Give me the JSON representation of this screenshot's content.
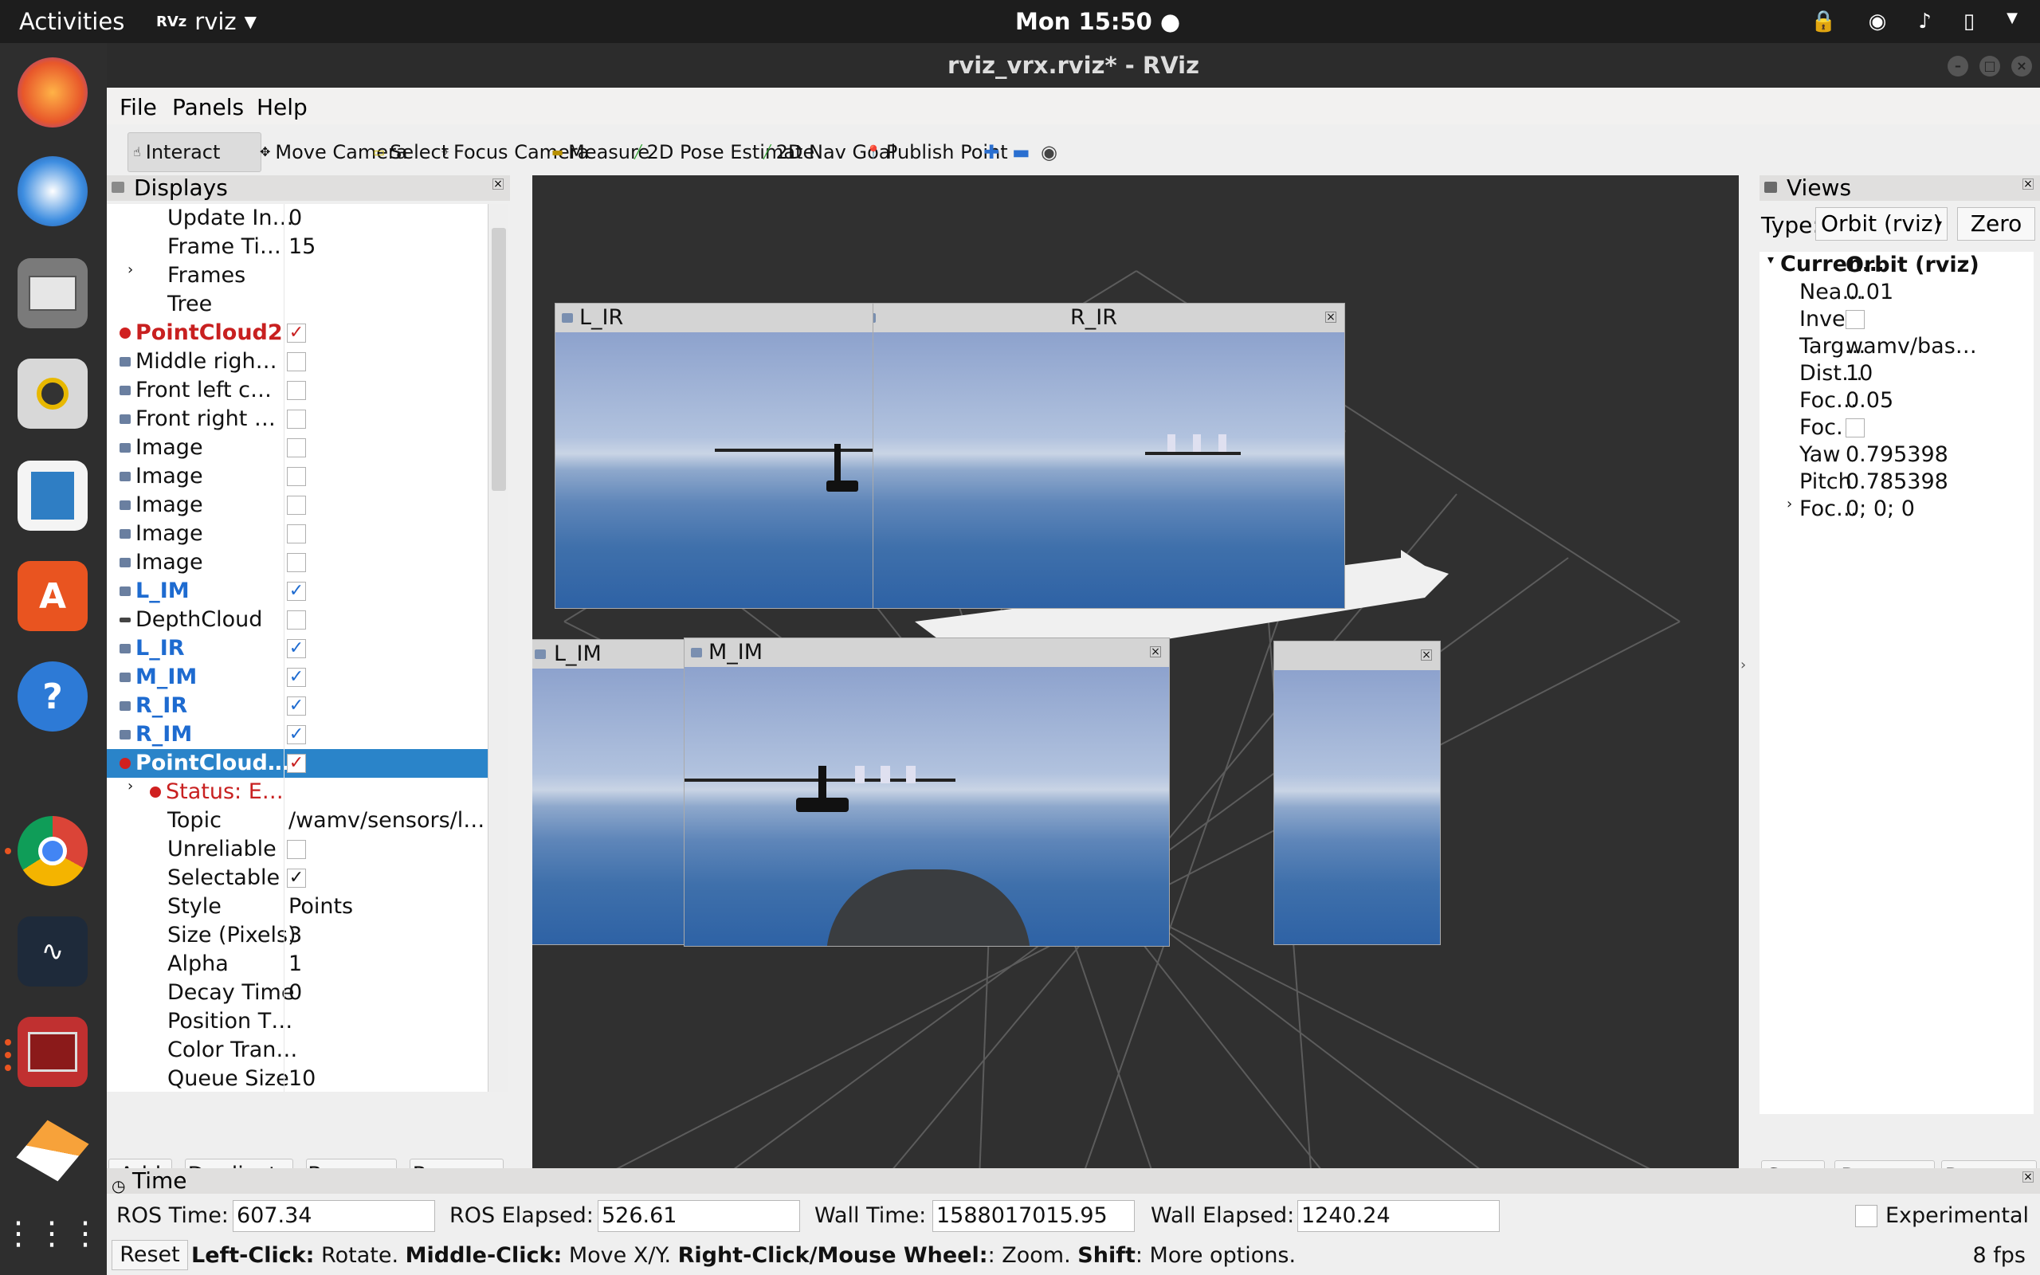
{
  "topbar": {
    "activities": "Activities",
    "app_name": "rviz",
    "app_logo": "RVz",
    "clock": "Mon 15:50 ●"
  },
  "window": {
    "title": "rviz_vrx.rviz* - RViz"
  },
  "menu": [
    "File",
    "Panels",
    "Help"
  ],
  "toolbar": {
    "interact": "Interact",
    "move_camera": "Move Camera",
    "select": "Select",
    "focus_camera": "Focus Camera",
    "measure": "Measure",
    "pose_estimate": "2D Pose Estimate",
    "nav_goal": "2D Nav Goal",
    "publish_point": "Publish Point"
  },
  "displays": {
    "title": "Displays",
    "rows": [
      {
        "name": "Update In…",
        "value": "0"
      },
      {
        "name": "Frame Ti…",
        "value": "15"
      },
      {
        "name": "Frames",
        "value": ""
      },
      {
        "name": "Tree",
        "value": ""
      },
      {
        "name": "PointCloud2",
        "value": ""
      },
      {
        "name": "Middle righ…",
        "value": ""
      },
      {
        "name": "Front left c…",
        "value": ""
      },
      {
        "name": "Front right …",
        "value": ""
      },
      {
        "name": "Image",
        "value": ""
      },
      {
        "name": "Image",
        "value": ""
      },
      {
        "name": "Image",
        "value": ""
      },
      {
        "name": "Image",
        "value": ""
      },
      {
        "name": "Image",
        "value": ""
      },
      {
        "name": "L_IM",
        "value": ""
      },
      {
        "name": "DepthCloud",
        "value": ""
      },
      {
        "name": "L_IR",
        "value": ""
      },
      {
        "name": "M_IM",
        "value": ""
      },
      {
        "name": "R_IR",
        "value": ""
      },
      {
        "name": "R_IM",
        "value": ""
      },
      {
        "name": "PointCloud…",
        "value": ""
      },
      {
        "name": "Status: E…",
        "value": ""
      },
      {
        "name": "Topic",
        "value": "/wamv/sensors/l…"
      },
      {
        "name": "Unreliable",
        "value": ""
      },
      {
        "name": "Selectable",
        "value": ""
      },
      {
        "name": "Style",
        "value": "Points"
      },
      {
        "name": "Size (Pixels)",
        "value": "3"
      },
      {
        "name": "Alpha",
        "value": "1"
      },
      {
        "name": "Decay Time",
        "value": "0"
      },
      {
        "name": "Position T…",
        "value": ""
      },
      {
        "name": "Color Tran…",
        "value": ""
      },
      {
        "name": "Queue Size",
        "value": "10"
      }
    ],
    "buttons": {
      "add": "Add",
      "duplicate": "Duplicate",
      "remove": "Remove",
      "rename": "Rename"
    }
  },
  "image_windows": {
    "l_ir": "L_IR",
    "r_ir": "R_IR",
    "l_im": "L_IM",
    "m_im": "M_IM"
  },
  "views": {
    "title": "Views",
    "type_label": "Type:",
    "type_value": "Orbit (rviz)",
    "zero": "Zero",
    "current_name": "Curren…",
    "current_value": "Orbit (rviz)",
    "props": [
      {
        "name": "Nea…",
        "value": "0.01"
      },
      {
        "name": "Inve…",
        "value": ""
      },
      {
        "name": "Targ…",
        "value": "wamv/bas…"
      },
      {
        "name": "Dist…",
        "value": "10"
      },
      {
        "name": "Foc…",
        "value": "0.05"
      },
      {
        "name": "Foc…",
        "value": ""
      },
      {
        "name": "Yaw",
        "value": "0.795398"
      },
      {
        "name": "Pitch",
        "value": "0.785398"
      },
      {
        "name": "Foc…",
        "value": "0; 0; 0"
      }
    ],
    "buttons": {
      "save": "Save",
      "remove": "Remove",
      "rename": "Rename"
    }
  },
  "time": {
    "title": "Time",
    "ros_time_label": "ROS Time:",
    "ros_time": "607.34",
    "ros_elapsed_label": "ROS Elapsed:",
    "ros_elapsed": "526.61",
    "wall_time_label": "Wall Time:",
    "wall_time": "1588017015.95",
    "wall_elapsed_label": "Wall Elapsed:",
    "wall_elapsed": "1240.24",
    "experimental": "Experimental"
  },
  "status": {
    "reset": "Reset",
    "left_click": "Left-Click:",
    "rotate": " Rotate. ",
    "middle_click": "Middle-Click:",
    "move": " Move X/Y. ",
    "right_click": "Right-Click/Mouse Wheel:",
    "zoom": ": Zoom. ",
    "shift": "Shift",
    "more": ": More options.",
    "fps": "8 fps"
  },
  "colors": {
    "selection": "#2a84c9",
    "error": "#c82020",
    "enabled": "#1e6bd0",
    "ubuntu_orange": "#e95420"
  }
}
